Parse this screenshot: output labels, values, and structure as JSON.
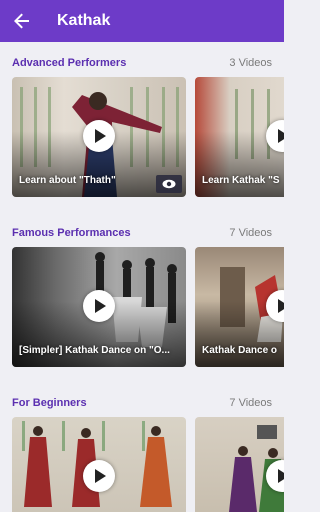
{
  "appbar": {
    "title": "Kathak"
  },
  "sections": [
    {
      "title": "Advanced Performers",
      "count": "3 Videos",
      "videos": [
        {
          "title": "Learn about \"Thath\""
        },
        {
          "title": "Learn Kathak \"S"
        }
      ]
    },
    {
      "title": "Famous Performances",
      "count": "7 Videos",
      "videos": [
        {
          "title": "[Simpler] Kathak Dance on \"O..."
        },
        {
          "title": "Kathak Dance o"
        }
      ]
    },
    {
      "title": "For Beginners",
      "count": "7 Videos",
      "videos": [
        {
          "title": ""
        },
        {
          "title": ""
        }
      ]
    }
  ],
  "icons": {
    "back": "arrow-left-icon",
    "play": "play-icon",
    "views": "eye-icon"
  }
}
